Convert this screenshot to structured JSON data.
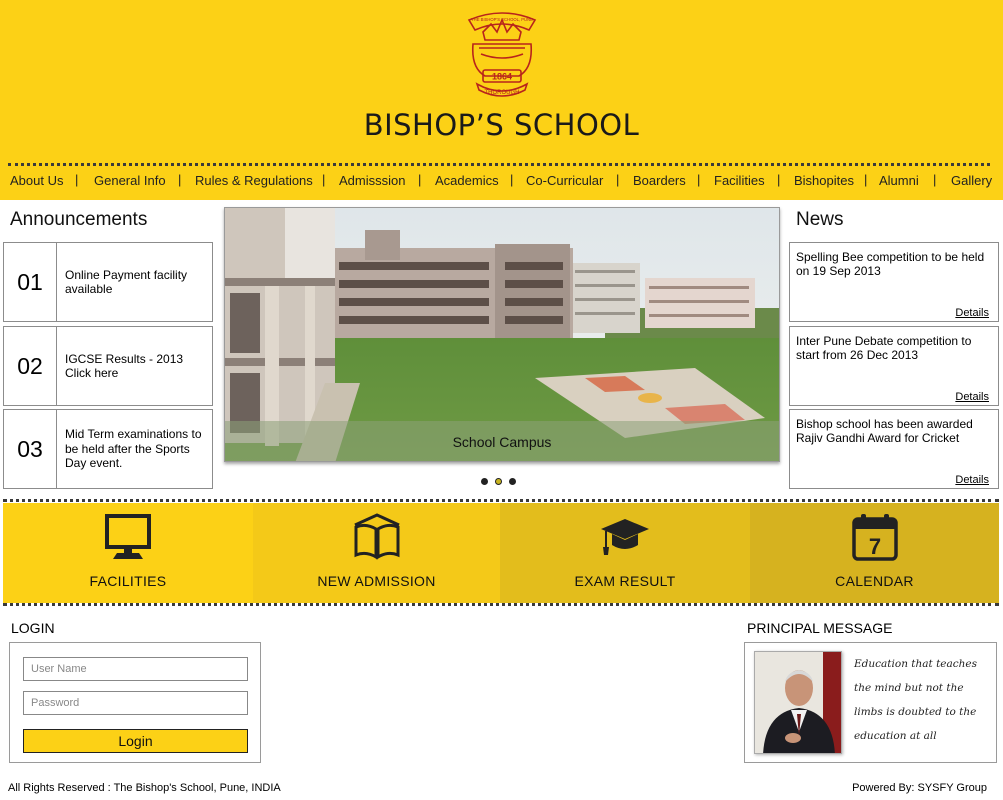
{
  "header": {
    "crest": {
      "top_text": "THE BISHOP'S SCHOOL, PUNE",
      "year": "1864",
      "motto": "THOROUGH"
    },
    "school_name": "BISHOP’S SCHOOL"
  },
  "nav": {
    "items": [
      {
        "label": "About Us"
      },
      {
        "label": "General Info"
      },
      {
        "label": "Rules & Regulations"
      },
      {
        "label": "Admisssion"
      },
      {
        "label": "Academics"
      },
      {
        "label": "Co-Curricular"
      },
      {
        "label": "Boarders"
      },
      {
        "label": "Facilities"
      },
      {
        "label": "Bishopites"
      },
      {
        "label": "Alumni"
      },
      {
        "label": "Gallery"
      }
    ],
    "separator": "|"
  },
  "announcements": {
    "title": "Announcements",
    "items": [
      {
        "number": "01",
        "text": " Online Payment facility available"
      },
      {
        "number": "02",
        "text": " IGCSE Results - 2013 Click here"
      },
      {
        "number": "03",
        "text": "Mid Term examinations to be held after the Sports Day event."
      }
    ]
  },
  "slider": {
    "caption": "School Campus",
    "slide_count": 3,
    "active_slide": 2
  },
  "news": {
    "title": "News",
    "items": [
      {
        "text": "Spelling Bee competition to be held on 19 Sep 2013",
        "details_label": "Details"
      },
      {
        "text": "Inter Pune Debate competition to start from 26 Dec 2013",
        "details_label": "Details"
      },
      {
        "text": "Bishop school has been awarded Rajiv Gandhi Award for Cricket",
        "details_label": "Details"
      }
    ]
  },
  "tiles": [
    {
      "label": "FACILITIES",
      "icon": "monitor-icon",
      "color": "#fcd116"
    },
    {
      "label": "NEW ADMISSION",
      "icon": "book-icon",
      "color": "#f4c918"
    },
    {
      "label": "EXAM RESULT",
      "icon": "graduation-cap-icon",
      "color": "#e3bd1c"
    },
    {
      "label": "CALENDAR",
      "icon": "calendar-icon",
      "color": "#d6b21f"
    }
  ],
  "calendar_day": "7",
  "login": {
    "title": "LOGIN",
    "username_placeholder": "User Name",
    "password_placeholder": "Password",
    "button_label": "Login"
  },
  "principal": {
    "title": "PRINCIPAL MESSAGE",
    "message": "Education that teaches the mind but not the limbs is doubted to the education at all"
  },
  "footer": {
    "left": "All Rights Reserved : The Bishop's School, Pune, INDIA",
    "right": "Powered By: SYSFY Group"
  },
  "colors": {
    "brand_yellow": "#fcd116",
    "crest_red": "#b8241c"
  }
}
